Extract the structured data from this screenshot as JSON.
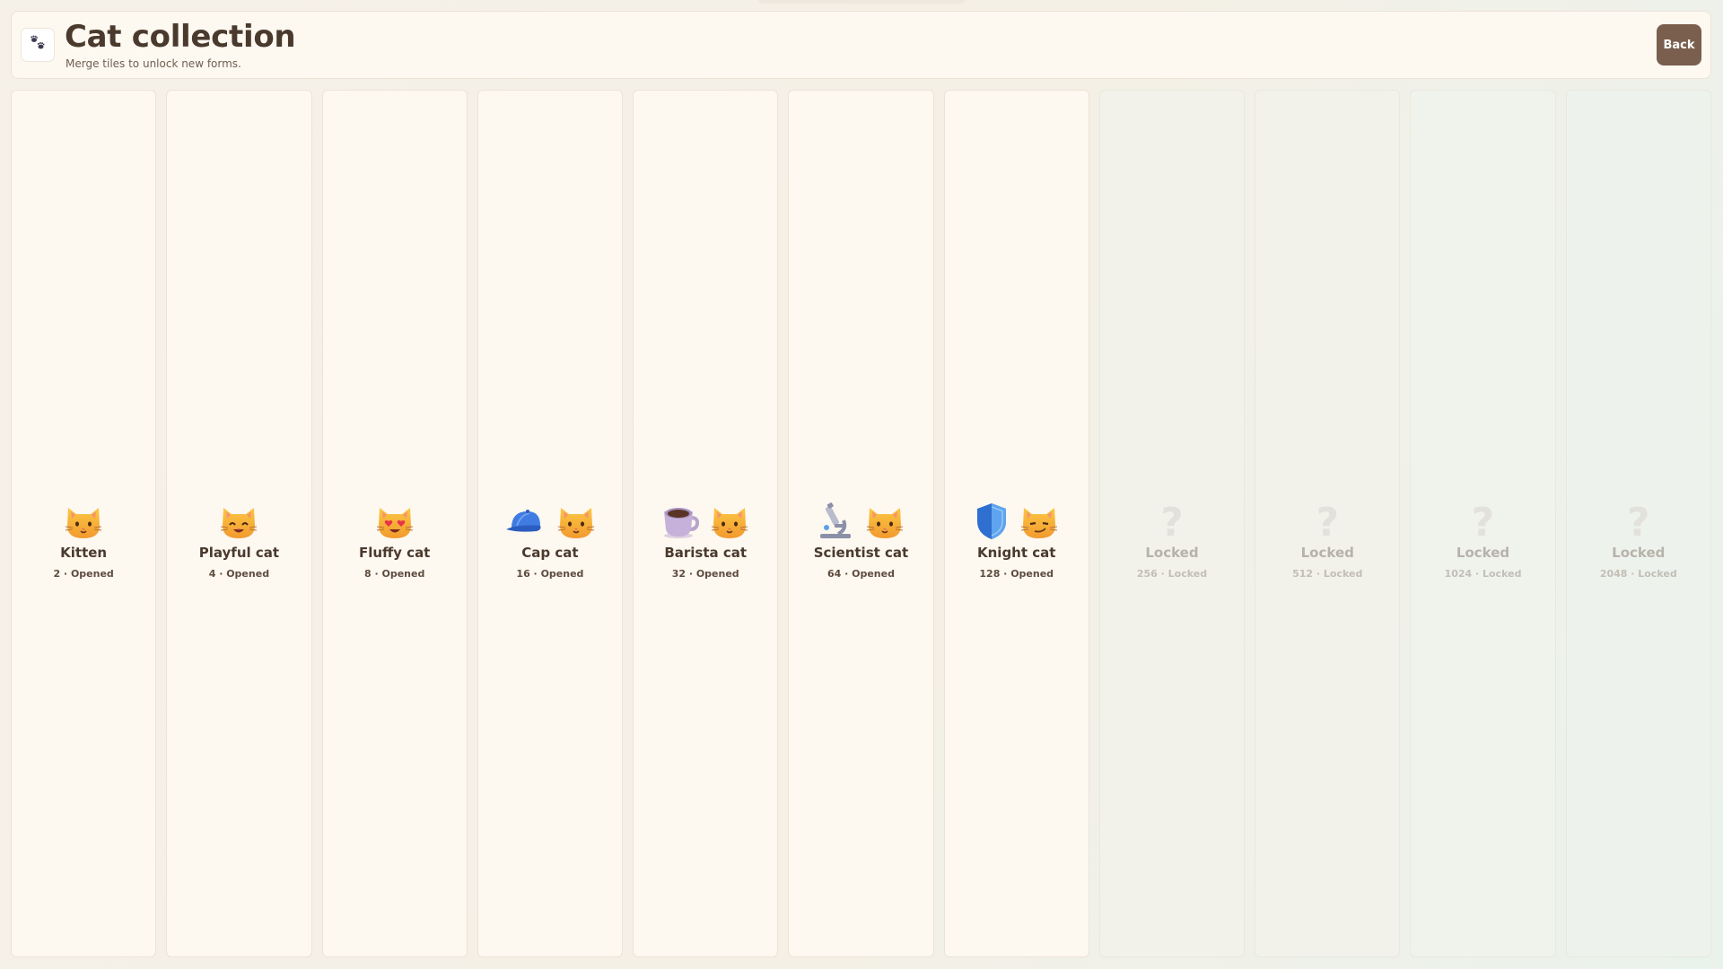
{
  "header": {
    "title": "Cat collection",
    "subtitle": "Merge tiles to unlock new forms.",
    "back_label": "Back",
    "logo_icon": "paw-prints-icon"
  },
  "cards": [
    {
      "name": "Kitten",
      "value": "2",
      "status": "Opened",
      "sub": "2 · Opened",
      "icons": [
        "cat-face-icon"
      ],
      "locked": false
    },
    {
      "name": "Playful cat",
      "value": "4",
      "status": "Opened",
      "sub": "4 · Opened",
      "icons": [
        "grinning-cat-icon"
      ],
      "locked": false
    },
    {
      "name": "Fluffy cat",
      "value": "8",
      "status": "Opened",
      "sub": "8 · Opened",
      "icons": [
        "heart-eyes-cat-icon"
      ],
      "locked": false
    },
    {
      "name": "Cap cat",
      "value": "16",
      "status": "Opened",
      "sub": "16 · Opened",
      "icons": [
        "blue-cap-icon",
        "cat-face-icon"
      ],
      "locked": false
    },
    {
      "name": "Barista cat",
      "value": "32",
      "status": "Opened",
      "sub": "32 · Opened",
      "icons": [
        "coffee-cup-icon",
        "cat-face-icon"
      ],
      "locked": false
    },
    {
      "name": "Scientist cat",
      "value": "64",
      "status": "Opened",
      "sub": "64 · Opened",
      "icons": [
        "microscope-icon",
        "cat-face-icon"
      ],
      "locked": false
    },
    {
      "name": "Knight cat",
      "value": "128",
      "status": "Opened",
      "sub": "128 · Opened",
      "icons": [
        "shield-icon",
        "smirking-cat-icon"
      ],
      "locked": false
    },
    {
      "name": "Locked",
      "value": "256",
      "status": "Locked",
      "sub": "256 · Locked",
      "icons": [
        "question-mark-icon"
      ],
      "locked": true
    },
    {
      "name": "Locked",
      "value": "512",
      "status": "Locked",
      "sub": "512 · Locked",
      "icons": [
        "question-mark-icon"
      ],
      "locked": true
    },
    {
      "name": "Locked",
      "value": "1024",
      "status": "Locked",
      "sub": "1024 · Locked",
      "icons": [
        "question-mark-icon"
      ],
      "locked": true
    },
    {
      "name": "Locked",
      "value": "2048",
      "status": "Locked",
      "sub": "2048 · Locked",
      "icons": [
        "question-mark-icon"
      ],
      "locked": true
    }
  ],
  "colors": {
    "accent": "#7a5f4e",
    "card_bg": "#fdf8f0",
    "locked_bg": "#f2f2ea",
    "text": "#4a3a2e",
    "cat_yellow": "#f5b534"
  }
}
